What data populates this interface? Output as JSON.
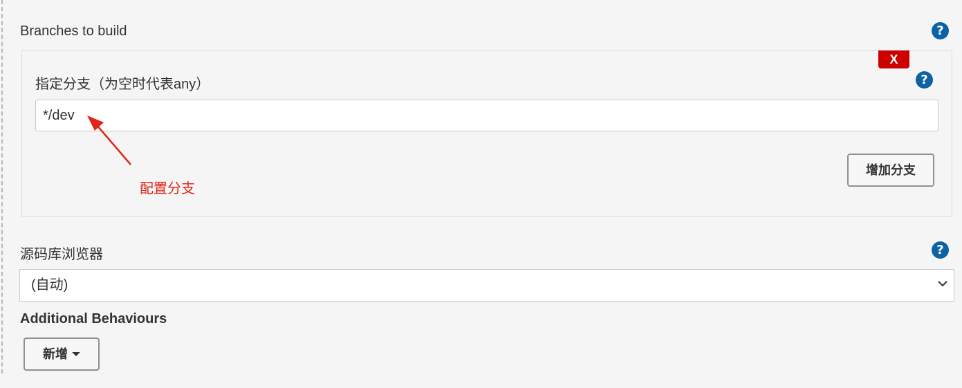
{
  "branches": {
    "title": "Branches to build",
    "delete_label": "X",
    "spec_label": "指定分支（为空时代表any）",
    "spec_value": "*/dev",
    "annotation": "配置分支",
    "add_button": "增加分支"
  },
  "repo_browser": {
    "label": "源码库浏览器",
    "selected": "(自动)"
  },
  "behaviours": {
    "label": "Additional Behaviours",
    "add_button": "新增"
  },
  "help": {
    "glyph": "?"
  },
  "colors": {
    "accent_help": "#0b62a4",
    "delete_red": "#cc0000",
    "annotation_red": "#e0261a"
  }
}
